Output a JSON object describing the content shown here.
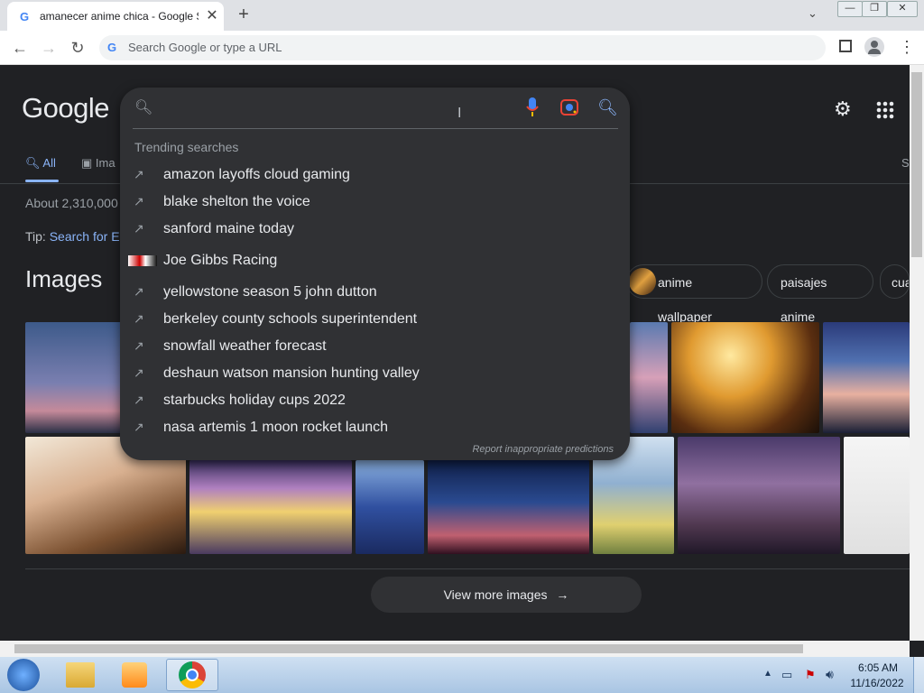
{
  "browser": {
    "tab_title": "amanecer anime chica - Google S",
    "tab_favicon": "G",
    "new_tab": "+",
    "omnibox_g": "G",
    "omnibox_placeholder": "Search Google or type a URL"
  },
  "google": {
    "logo": "Google",
    "tabs": {
      "all": "All",
      "images": "Ima",
      "right_cut": "S"
    },
    "result_stats": "About 2,310,000",
    "tip_prefix": "Tip: ",
    "tip_link": "Search for E",
    "images_heading": "Images",
    "chips": [
      "anime wallpaper",
      "paisajes anime",
      "cua"
    ],
    "view_more": "View more images"
  },
  "dropdown": {
    "section_title": "Trending searches",
    "suggestions": [
      "amazon layoffs cloud gaming",
      "blake shelton the voice",
      "sanford maine today",
      "Joe Gibbs Racing",
      "yellowstone season 5 john dutton",
      "berkeley county schools superintendent",
      "snowfall weather forecast",
      "deshaun watson mansion hunting valley",
      "starbucks holiday cups 2022",
      "nasa artemis 1 moon rocket launch"
    ],
    "report": "Report inappropriate predictions"
  },
  "taskbar": {
    "time": "6:05 AM",
    "date": "11/16/2022"
  },
  "colors": {
    "page_bg": "#202124",
    "dropdown_bg": "#303134",
    "link_blue": "#8ab4f8",
    "text": "#e8eaed"
  }
}
